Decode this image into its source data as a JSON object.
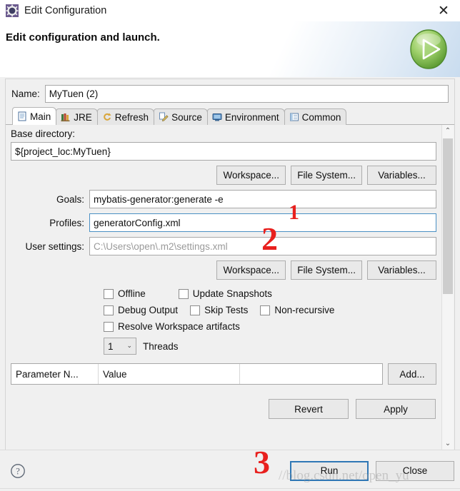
{
  "window": {
    "title": "Edit Configuration",
    "icon": "gear-icon",
    "close_label": "✕"
  },
  "banner": {
    "headline": "Edit configuration and launch.",
    "icon": "run-play-icon"
  },
  "name_field": {
    "label": "Name:",
    "value": "MyTuen (2)"
  },
  "tabs": [
    {
      "label": "Main",
      "icon": "document-icon",
      "active": true
    },
    {
      "label": "JRE",
      "icon": "books-icon",
      "active": false
    },
    {
      "label": "Refresh",
      "icon": "refresh-icon",
      "active": false
    },
    {
      "label": "Source",
      "icon": "source-edit-icon",
      "active": false
    },
    {
      "label": "Environment",
      "icon": "environment-icon",
      "active": false
    },
    {
      "label": "Common",
      "icon": "common-icon",
      "active": false
    }
  ],
  "main_tab": {
    "base_directory": {
      "label": "Base directory:",
      "value": "${project_loc:MyTuen}"
    },
    "browse_buttons_top": [
      {
        "label": "Workspace..."
      },
      {
        "label": "File System..."
      },
      {
        "label": "Variables..."
      }
    ],
    "fields": [
      {
        "label": "Goals:",
        "value": "mybatis-generator:generate -e",
        "state": "normal"
      },
      {
        "label": "Profiles:",
        "value": "generatorConfig.xml",
        "state": "focused"
      },
      {
        "label": "User settings:",
        "value": "C:\\Users\\open\\.m2\\settings.xml",
        "state": "readonly"
      }
    ],
    "browse_buttons_bottom": [
      {
        "label": "Workspace..."
      },
      {
        "label": "File System..."
      },
      {
        "label": "Variables..."
      }
    ],
    "checkbox_rows": [
      [
        {
          "label": "Offline",
          "checked": false
        },
        {
          "label": "Update Snapshots",
          "checked": false
        }
      ],
      [
        {
          "label": "Debug Output",
          "checked": false
        },
        {
          "label": "Skip Tests",
          "checked": false
        },
        {
          "label": "Non-recursive",
          "checked": false
        }
      ],
      [
        {
          "label": "Resolve Workspace artifacts",
          "checked": false
        }
      ]
    ],
    "threads": {
      "value": "1",
      "label": "Threads",
      "arrow": "⌄"
    },
    "parameter_table": {
      "columns": [
        "Parameter N...",
        "Value",
        ""
      ],
      "rows": [],
      "add_button": "Add..."
    },
    "revert_label": "Revert",
    "apply_label": "Apply"
  },
  "scrollbar": {
    "up_arrow": "⌃",
    "down_arrow": "⌄"
  },
  "footer": {
    "help_icon": "help-question-icon",
    "run_label": "Run",
    "close_label": "Close"
  },
  "annotations": [
    {
      "id": "annot-1",
      "text": "1"
    },
    {
      "id": "annot-2",
      "text": "2"
    },
    {
      "id": "annot-3",
      "text": "3"
    }
  ],
  "watermark": "//blog.csdn.net/open_yu",
  "colors": {
    "dialog_bg": "#f0f0f0",
    "focus_blue": "#2f77b5",
    "annotation_red": "#e8201e",
    "run_icon_green": "#79b648"
  }
}
